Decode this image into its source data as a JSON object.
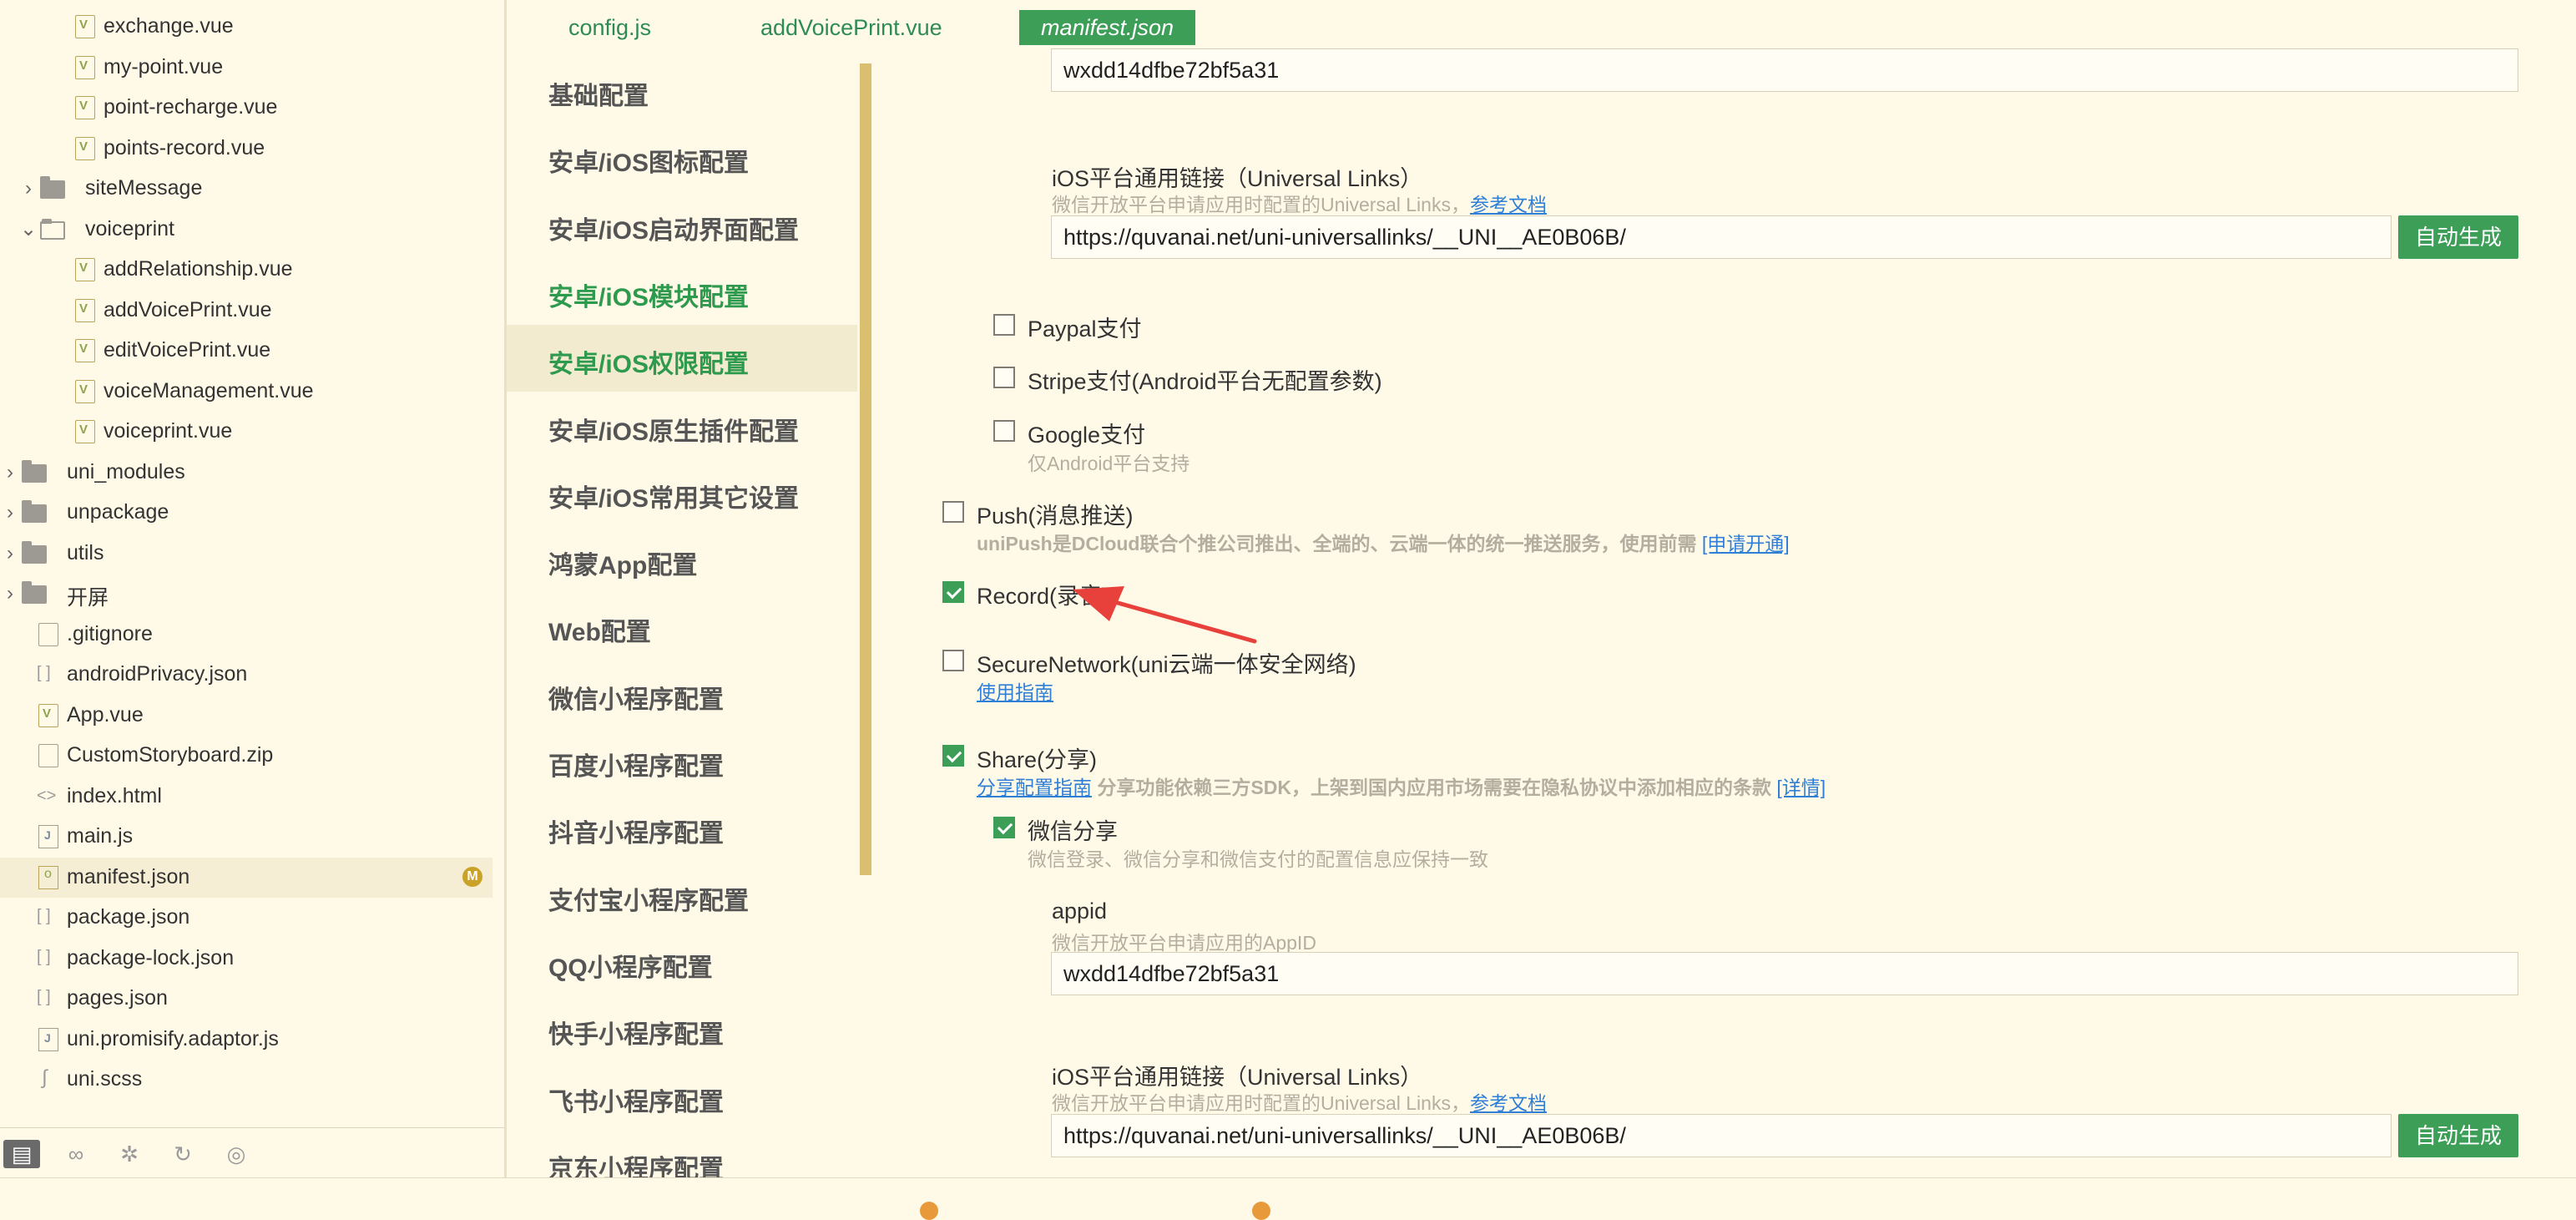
{
  "file_tree": {
    "items": [
      {
        "label": "exchange.vue",
        "type": "vue",
        "indent": 3
      },
      {
        "label": "my-point.vue",
        "type": "vue",
        "indent": 3
      },
      {
        "label": "point-recharge.vue",
        "type": "vue",
        "indent": 3
      },
      {
        "label": "points-record.vue",
        "type": "vue",
        "indent": 3
      },
      {
        "label": "siteMessage",
        "type": "folder",
        "indent": 2,
        "expanded": false
      },
      {
        "label": "voiceprint",
        "type": "folder",
        "indent": 2,
        "expanded": true
      },
      {
        "label": "addRelationship.vue",
        "type": "vue",
        "indent": 3
      },
      {
        "label": "addVoicePrint.vue",
        "type": "vue",
        "indent": 3
      },
      {
        "label": "editVoicePrint.vue",
        "type": "vue",
        "indent": 3
      },
      {
        "label": "voiceManagement.vue",
        "type": "vue",
        "indent": 3
      },
      {
        "label": "voiceprint.vue",
        "type": "vue",
        "indent": 3
      },
      {
        "label": "uni_modules",
        "type": "folder",
        "indent": 1,
        "expanded": false
      },
      {
        "label": "unpackage",
        "type": "folder",
        "indent": 1,
        "expanded": false
      },
      {
        "label": "utils",
        "type": "folder",
        "indent": 1,
        "expanded": false
      },
      {
        "label": "开屏",
        "type": "folder",
        "indent": 1,
        "expanded": false
      },
      {
        "label": ".gitignore",
        "type": "file",
        "indent": 1
      },
      {
        "label": "androidPrivacy.json",
        "type": "json",
        "indent": 1
      },
      {
        "label": "App.vue",
        "type": "vue",
        "indent": 1
      },
      {
        "label": "CustomStoryboard.zip",
        "type": "file",
        "indent": 1
      },
      {
        "label": "index.html",
        "type": "html",
        "indent": 1
      },
      {
        "label": "main.js",
        "type": "js",
        "indent": 1
      },
      {
        "label": "manifest.json",
        "type": "cfg",
        "indent": 1,
        "selected": true,
        "badge": "M"
      },
      {
        "label": "package.json",
        "type": "json",
        "indent": 1
      },
      {
        "label": "package-lock.json",
        "type": "json",
        "indent": 1
      },
      {
        "label": "pages.json",
        "type": "json",
        "indent": 1
      },
      {
        "label": "uni.promisify.adaptor.js",
        "type": "js",
        "indent": 1
      },
      {
        "label": "uni.scss",
        "type": "css",
        "indent": 1
      }
    ],
    "bottom_icons": [
      "folder-icon",
      "binoculars-icon",
      "bug-icon",
      "refresh-icon",
      "globe-icon"
    ]
  },
  "tabs": [
    {
      "label": "config.js",
      "active": false
    },
    {
      "label": "addVoicePrint.vue",
      "active": false
    },
    {
      "label": "manifest.json",
      "active": true
    }
  ],
  "nav": {
    "items": [
      {
        "label": "基础配置"
      },
      {
        "label": "安卓/iOS图标配置"
      },
      {
        "label": "安卓/iOS启动界面配置"
      },
      {
        "label": "安卓/iOS模块配置",
        "green": true
      },
      {
        "label": "安卓/iOS权限配置",
        "selected": true
      },
      {
        "label": "安卓/iOS原生插件配置"
      },
      {
        "label": "安卓/iOS常用其它设置"
      },
      {
        "label": "鸿蒙App配置"
      },
      {
        "label": "Web配置"
      },
      {
        "label": "微信小程序配置"
      },
      {
        "label": "百度小程序配置"
      },
      {
        "label": "抖音小程序配置"
      },
      {
        "label": "支付宝小程序配置"
      },
      {
        "label": "QQ小程序配置"
      },
      {
        "label": "快手小程序配置"
      },
      {
        "label": "飞书小程序配置"
      },
      {
        "label": "京东小程序配置"
      }
    ]
  },
  "content": {
    "top_appid_value": "wxdd14dfbe72bf5a31",
    "ul1_label": "iOS平台通用链接（Universal Links）",
    "ul1_hint": "微信开放平台申请应用时配置的Universal Links，",
    "ul1_link": "参考文档",
    "ul1_value": "https://quvanai.net/uni-universallinks/__UNI__AE0B06B/",
    "generate_label": "自动生成",
    "paypal_label": "Paypal支付",
    "stripe_label": "Stripe支付(Android平台无配置参数)",
    "google_label": "Google支付",
    "google_hint": "仅Android平台支持",
    "push_label": "Push(消息推送)",
    "push_hint_bold": "uniPush是DCloud联合个推公司推出、全端的、云端一体的统一推送服务，使用前需",
    "push_link": "[申请开通]",
    "record_label": "Record(录音)",
    "secure_label": "SecureNetwork(uni云端一体安全网络)",
    "secure_link": "使用指南",
    "share_label": "Share(分享)",
    "share_link": "分享配置指南",
    "share_hint": "分享功能依赖三方SDK，上架到国内应用市场需要在隐私协议中添加相应的条款",
    "share_detail_link": "[详情]",
    "wx_share_label": "微信分享",
    "wx_share_hint": "微信登录、微信分享和微信支付的配置信息应保持一致",
    "appid_label": "appid",
    "appid_hint": "微信开放平台申请应用的AppID",
    "appid_value": "wxdd14dfbe72bf5a31",
    "ul2_label": "iOS平台通用链接（Universal Links）",
    "ul2_hint": "微信开放平台申请应用时配置的Universal Links，",
    "ul2_link": "参考文档",
    "ul2_value": "https://quvanai.net/uni-universallinks/__UNI__AE0B06B/",
    "checks": {
      "paypal": false,
      "stripe": false,
      "google": false,
      "push": false,
      "record": true,
      "secure": false,
      "share": true,
      "wx_share": true
    }
  },
  "colors": {
    "accent": "#3d9e58",
    "bg": "#fffae8",
    "link": "#2f7fd6",
    "arrow": "#e8403a"
  }
}
